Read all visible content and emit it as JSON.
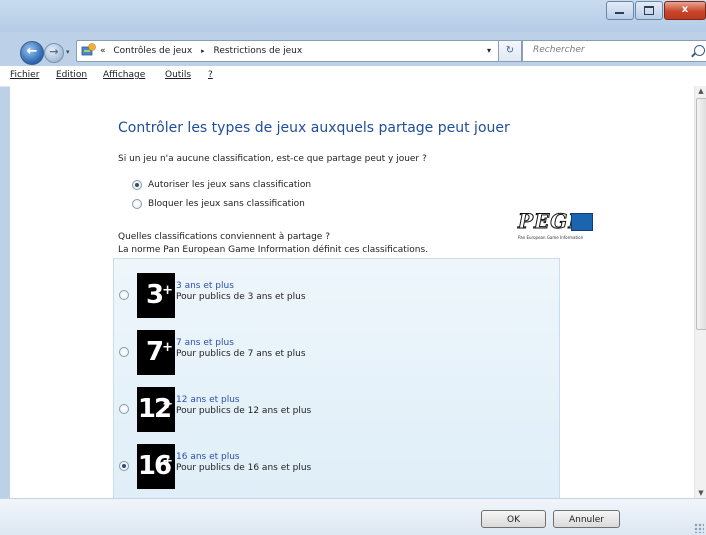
{
  "window": {
    "close_glyph": "x",
    "accent_color": "#1f4e9a"
  },
  "nav": {
    "back_glyph": "←",
    "forward_glyph": "→",
    "dropdown_glyph": "▾"
  },
  "address": {
    "overflow": "«",
    "separator": "▸",
    "crumbs": [
      "Contrôles de jeux",
      "Restrictions de jeux"
    ],
    "dropdown_glyph": "▾",
    "refresh_glyph": "↻"
  },
  "search": {
    "placeholder": "Rechercher"
  },
  "menu": {
    "items": [
      {
        "label": "Fichier"
      },
      {
        "label": "Edition"
      },
      {
        "label": "Affichage"
      },
      {
        "label": "Outils"
      },
      {
        "label": "?"
      }
    ]
  },
  "main": {
    "heading": "Contrôler les types de jeux auxquels partage peut jouer",
    "question": "Si un jeu n'a aucune classification, est-ce que partage peut y jouer ?",
    "unrated_options": [
      {
        "label": "Autoriser les jeux sans classification",
        "selected": true
      },
      {
        "label": "Bloquer les jeux sans classification",
        "selected": false
      }
    ],
    "ratings_question_line1": "Quelles classifications conviennent à partage ?",
    "ratings_question_line2": "La norme Pan European Game Information définit ces classifications.",
    "pegi_logo": {
      "text": "PEGI",
      "subtitle": "Pan European Game Information"
    },
    "ratings": [
      {
        "age": "3",
        "plus": "+",
        "title": "3 ans et plus",
        "desc": "Pour publics de 3 ans et plus",
        "selected": false
      },
      {
        "age": "7",
        "plus": "+",
        "title": "7 ans et plus",
        "desc": "Pour publics de 7 ans et plus",
        "selected": false
      },
      {
        "age": "12",
        "plus": "+",
        "title": "12 ans et plus",
        "desc": "Pour publics de 12 ans et plus",
        "selected": false
      },
      {
        "age": "16",
        "plus": "+",
        "title": "16 ans et plus",
        "desc": "Pour publics de 16 ans et plus",
        "selected": true
      }
    ]
  },
  "buttons": {
    "ok": "OK",
    "cancel": "Annuler"
  },
  "scrollbar": {
    "up_glyph": "▲",
    "down_glyph": "▼"
  }
}
